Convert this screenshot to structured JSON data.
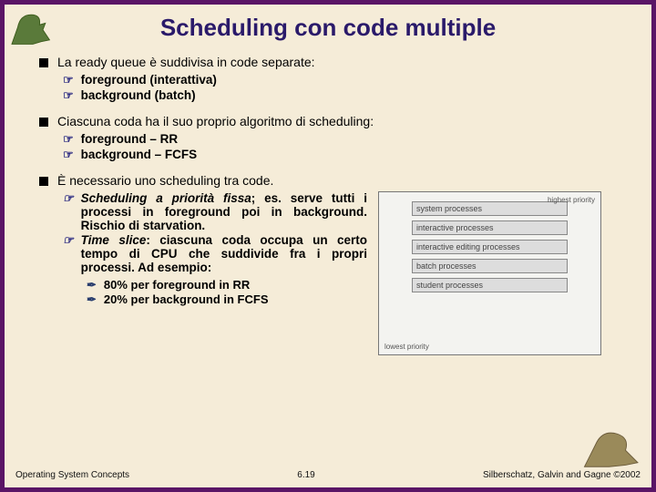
{
  "title": "Scheduling con code multiple",
  "bullets": {
    "b1": {
      "text": "La ready queue è suddivisa in code separate:",
      "subs": [
        "foreground (interattiva)",
        "background (batch)"
      ]
    },
    "b2": {
      "text": "Ciascuna coda ha il suo proprio algoritmo di scheduling:",
      "subs": [
        "foreground – RR",
        "background – FCFS"
      ]
    },
    "b3": {
      "text": "È necessario uno scheduling tra code.",
      "subs": [
        {
          "em": "Scheduling a priorità fissa",
          "rest": "; es. serve tutti i processi in foreground poi in background. Rischio di starvation."
        },
        {
          "em": "Time slice",
          "rest": ": ciascuna coda occupa un certo tempo di CPU che suddivide fra i propri processi. Ad esempio:"
        }
      ],
      "subsubs": [
        "80% per foreground in RR",
        "20% per background in FCFS"
      ]
    }
  },
  "diagram": {
    "top_label": "highest priority",
    "bottom_label": "lowest priority",
    "boxes": [
      "system processes",
      "interactive processes",
      "interactive editing processes",
      "batch processes",
      "student processes"
    ]
  },
  "footer": {
    "left": "Operating System Concepts",
    "center": "6.19",
    "right": "Silberschatz, Galvin and Gagne ©2002"
  }
}
